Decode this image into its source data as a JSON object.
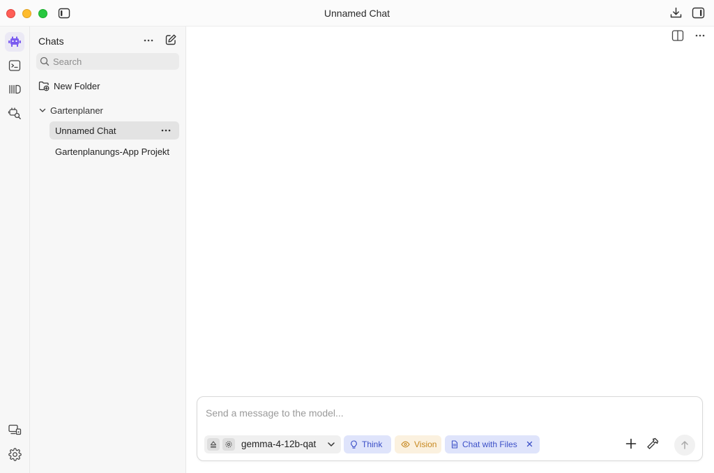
{
  "window": {
    "title": "Unnamed Chat"
  },
  "icons": {
    "sidebar_toggle": "sidebar-toggle-icon",
    "download": "download-icon",
    "right_panel": "right-panel-icon",
    "app_logo": "robot-logo-icon",
    "terminal": "terminal-icon",
    "library": "library-icon",
    "search_models": "model-search-icon",
    "devices": "devices-icon",
    "settings": "gear-icon"
  },
  "sidebar": {
    "title": "Chats",
    "search": {
      "placeholder": "Search"
    },
    "new_folder_label": "New Folder",
    "folders": [
      {
        "name": "Gartenplaner",
        "chats": [
          {
            "title": "Unnamed Chat",
            "selected": true
          },
          {
            "title": "Gartenplanungs-App Projekt",
            "selected": false
          }
        ]
      }
    ]
  },
  "composer": {
    "placeholder": "Send a message to the model...",
    "model_name": "gemma-4-12b-qat",
    "chips": {
      "think": "Think",
      "vision": "Vision",
      "files": "Chat with Files"
    }
  },
  "colors": {
    "accent": "#7b5cf0",
    "think_text": "#3b4fc7",
    "think_bg": "#dfe4fb",
    "vision_text": "#c6871e",
    "vision_bg": "#fbf1df"
  }
}
